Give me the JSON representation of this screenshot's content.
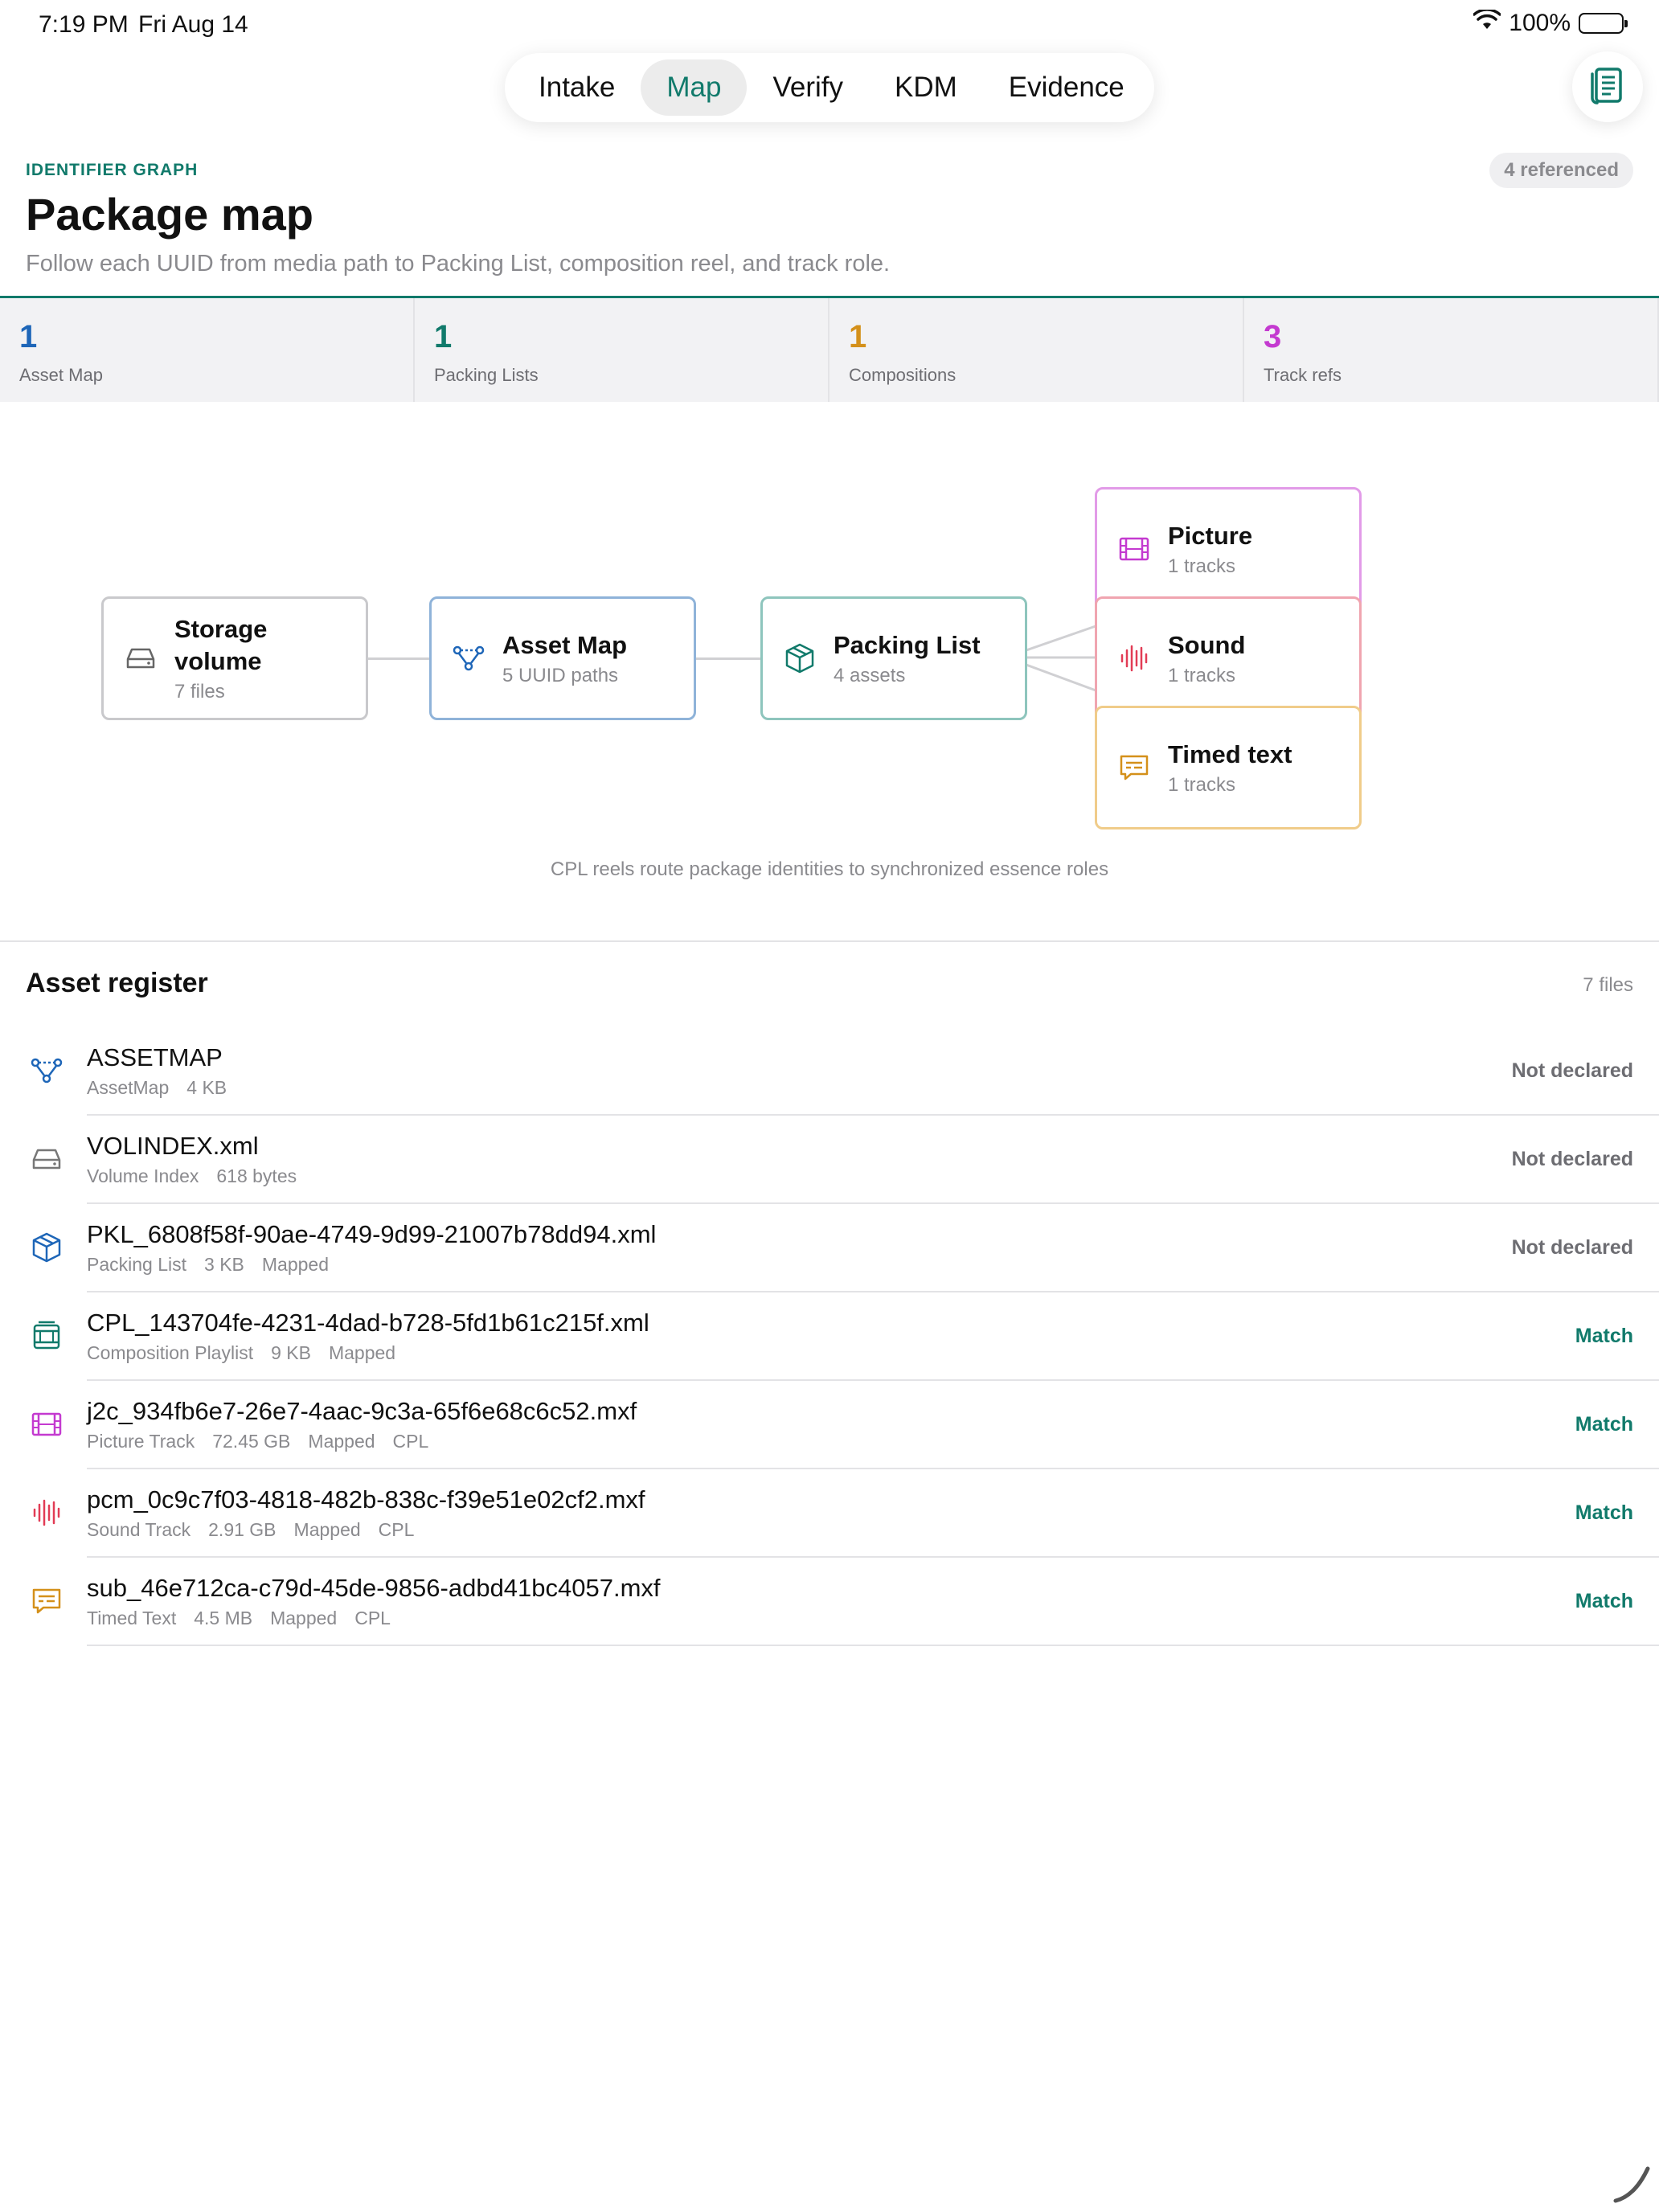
{
  "status": {
    "time": "7:19 PM",
    "date": "Fri Aug 14",
    "battery": "100%"
  },
  "tabs": [
    {
      "label": "Intake",
      "active": false
    },
    {
      "label": "Map",
      "active": true
    },
    {
      "label": "Verify",
      "active": false
    },
    {
      "label": "KDM",
      "active": false
    },
    {
      "label": "Evidence",
      "active": false
    }
  ],
  "header": {
    "eyebrow": "IDENTIFIER GRAPH",
    "title": "Package map",
    "subtitle": "Follow each UUID from media path to Packing List, composition reel, and track role.",
    "badge": "4 referenced"
  },
  "stats": [
    {
      "value": "1",
      "label": "Asset Map",
      "color": "#1e66b8"
    },
    {
      "value": "1",
      "label": "Packing Lists",
      "color": "#117a6b"
    },
    {
      "value": "1",
      "label": "Compositions",
      "color": "#d4901a"
    },
    {
      "value": "3",
      "label": "Track refs",
      "color": "#c43ad0"
    }
  ],
  "diagram": {
    "nodes": {
      "storage": {
        "title": "Storage volume",
        "sub": "7 files",
        "icon": "drive-icon",
        "border": "#c9c9cc"
      },
      "assetmap": {
        "title": "Asset Map",
        "sub": "5 UUID paths",
        "icon": "graph-icon",
        "border": "#8fb3d9"
      },
      "packing": {
        "title": "Packing List",
        "sub": "4 assets",
        "icon": "box-icon",
        "border": "#8ec5bd"
      },
      "picture": {
        "title": "Picture",
        "sub": "1 tracks",
        "icon": "film-icon",
        "border": "#e29be8"
      },
      "sound": {
        "title": "Sound",
        "sub": "1 tracks",
        "icon": "waveform-icon",
        "border": "#f0a5b0"
      },
      "timedtext": {
        "title": "Timed text",
        "sub": "1 tracks",
        "icon": "caption-icon",
        "border": "#f0cc8a"
      }
    },
    "caption": "CPL reels route package identities to synchronized essence roles"
  },
  "register": {
    "title": "Asset register",
    "count": "7 files",
    "rows": [
      {
        "name": "ASSETMAP",
        "meta": [
          "AssetMap",
          "4 KB"
        ],
        "status": "Not declared",
        "icon": "graph-icon",
        "match": false
      },
      {
        "name": "VOLINDEX.xml",
        "meta": [
          "Volume Index",
          "618 bytes"
        ],
        "status": "Not declared",
        "icon": "drive-icon",
        "match": false
      },
      {
        "name": "PKL_6808f58f-90ae-4749-9d99-21007b78dd94.xml",
        "meta": [
          "Packing List",
          "3 KB",
          "Mapped"
        ],
        "status": "Not declared",
        "icon": "box-icon",
        "match": false
      },
      {
        "name": "CPL_143704fe-4231-4dad-b728-5fd1b61c215f.xml",
        "meta": [
          "Composition Playlist",
          "9 KB",
          "Mapped"
        ],
        "status": "Match",
        "icon": "reel-icon",
        "match": true
      },
      {
        "name": "j2c_934fb6e7-26e7-4aac-9c3a-65f6e68c6c52.mxf",
        "meta": [
          "Picture Track",
          "72.45 GB",
          "Mapped",
          "CPL"
        ],
        "status": "Match",
        "icon": "film-icon",
        "match": true
      },
      {
        "name": "pcm_0c9c7f03-4818-482b-838c-f39e51e02cf2.mxf",
        "meta": [
          "Sound Track",
          "2.91 GB",
          "Mapped",
          "CPL"
        ],
        "status": "Match",
        "icon": "waveform-icon",
        "match": true
      },
      {
        "name": "sub_46e712ca-c79d-45de-9856-adbd41bc4057.mxf",
        "meta": [
          "Timed Text",
          "4.5 MB",
          "Mapped",
          "CPL"
        ],
        "status": "Match",
        "icon": "caption-icon",
        "match": true
      }
    ]
  },
  "colors": {
    "accent": "#117a6b",
    "match": "#117a6b",
    "muted": "#8a8a8e"
  }
}
